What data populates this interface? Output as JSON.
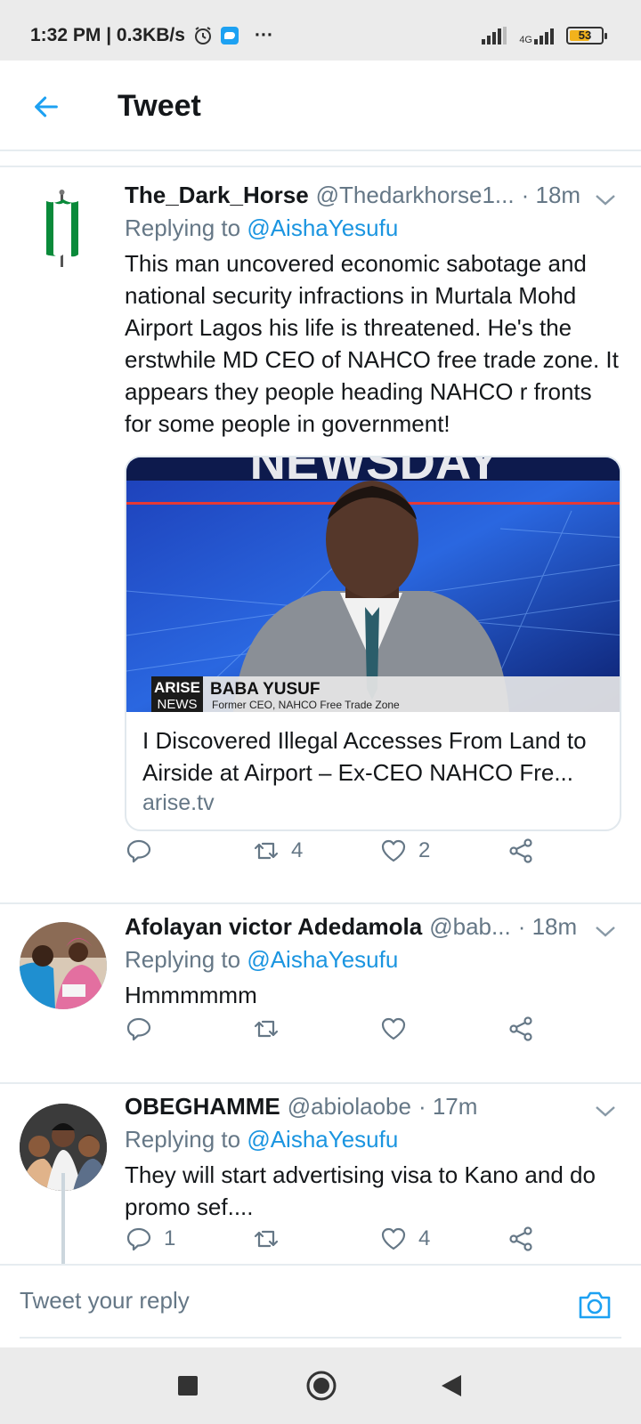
{
  "status_bar": {
    "time_speed": "1:32 PM | 0.3KB/s",
    "network": "4G",
    "battery": "53",
    "more": "···"
  },
  "header": {
    "title": "Tweet"
  },
  "tweets": [
    {
      "name": "The_Dark_Horse",
      "handle": "@Thedarkhorse1...",
      "time": "· 18m",
      "replying_label": "Replying to",
      "replying_to": "@AishaYesufu",
      "text": "This man uncovered economic sabotage and national security infractions in Murtala Mohd Airport Lagos his life is threatened. He's the erstwhile MD CEO of NAHCO free trade zone. It appears they people heading NAHCO r fronts for some people in government!",
      "card": {
        "image_banner": "NEWSDAY",
        "lower_third_brand_top": "ARISE",
        "lower_third_brand_bottom": "NEWS",
        "lower_third_name": "BABA YUSUF",
        "lower_third_role": "Former CEO, NAHCO Free Trade Zone",
        "title": "I Discovered Illegal Accesses From Land to Airside at Airport – Ex-CEO NAHCO Fre...",
        "domain": "arise.tv"
      },
      "retweets": "4",
      "likes": "2"
    },
    {
      "name": "Afolayan victor Adedamola",
      "handle": "@bab...",
      "time": "· 18m",
      "replying_label": "Replying to",
      "replying_to": "@AishaYesufu",
      "text": "Hmmmmmm"
    },
    {
      "name": "OBEGHAMME",
      "handle": "@abiolaobe",
      "time": "· 17m",
      "replying_label": "Replying to",
      "replying_to": "@AishaYesufu",
      "text": "They will start advertising visa to Kano and do promo sef....",
      "replies": "1",
      "likes": "4"
    }
  ],
  "composer": {
    "placeholder": "Tweet your reply"
  },
  "icons": {
    "accent": "#1da1f2",
    "muted": "#657786"
  }
}
